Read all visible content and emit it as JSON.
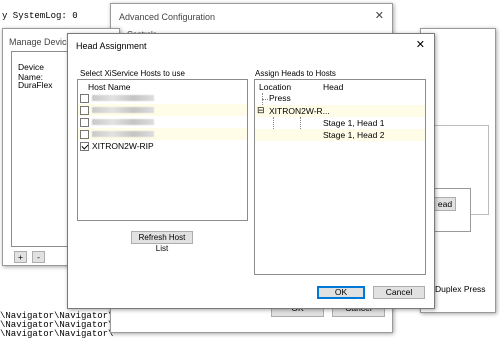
{
  "syslog_text": "y SystemLog: 0",
  "console_lines": [
    "\\Navigator\\Navigator\\",
    "\\Navigator\\Navigator\\",
    "\\Navigator\\Navigator\\"
  ],
  "advanced_config": {
    "title": "Advanced Configuration",
    "partial_label": "Controls",
    "head_button_partial": "ead",
    "duplex_label": "Duplex Press",
    "ok": "OK",
    "cancel": "Cancel"
  },
  "manage_devices": {
    "title": "Manage Devices",
    "device_name_label": "Device Name:",
    "device": "DuraFlex",
    "add": "+",
    "remove": "-"
  },
  "head_assignment": {
    "title": "Head Assignment",
    "hosts_label": "Select XiService Hosts to use",
    "host_col": "Host Name",
    "hosts": [
      {
        "name": "",
        "checked": false,
        "blurred": true
      },
      {
        "name": "",
        "checked": false,
        "blurred": true
      },
      {
        "name": "",
        "checked": false,
        "blurred": true
      },
      {
        "name": "",
        "checked": false,
        "blurred": true
      },
      {
        "name": "XITRON2W-RIP",
        "checked": true,
        "blurred": false
      }
    ],
    "refresh_button": "Refresh Host List",
    "assign_label": "Assign Heads to Hosts",
    "col_location": "Location",
    "col_head": "Head",
    "tree": {
      "press": "Press",
      "host_node": "XITRON2W-R...",
      "expander": "⊟",
      "heads": [
        "Stage 1, Head 1",
        "Stage 1, Head 2"
      ]
    },
    "ok": "OK",
    "cancel": "Cancel"
  }
}
